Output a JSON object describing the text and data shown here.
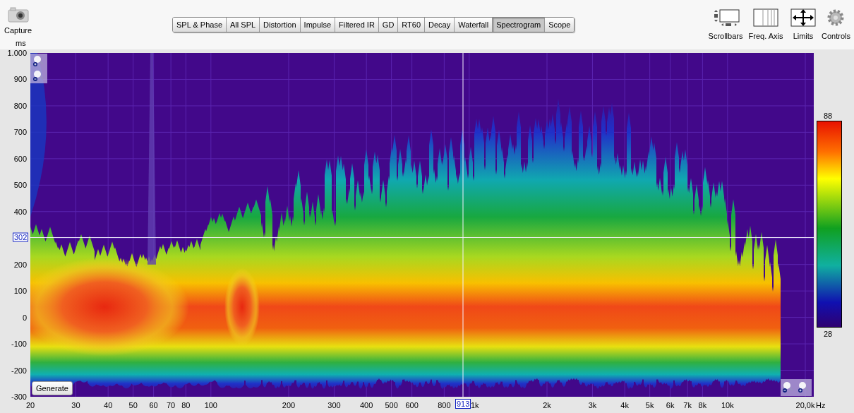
{
  "toolbar": {
    "capture": "Capture",
    "tabs": [
      {
        "label": "SPL & Phase",
        "selected": false
      },
      {
        "label": "All SPL",
        "selected": false
      },
      {
        "label": "Distortion",
        "selected": false
      },
      {
        "label": "Impulse",
        "selected": false
      },
      {
        "label": "Filtered IR",
        "selected": false
      },
      {
        "label": "GD",
        "selected": false
      },
      {
        "label": "RT60",
        "selected": false
      },
      {
        "label": "Decay",
        "selected": false
      },
      {
        "label": "Waterfall",
        "selected": false
      },
      {
        "label": "Spectrogram",
        "selected": true
      },
      {
        "label": "Scope",
        "selected": false
      }
    ],
    "tools": [
      {
        "kind": "scrollbars",
        "label": "Scrollbars"
      },
      {
        "kind": "axis",
        "label": "Freq. Axis"
      },
      {
        "kind": "limits",
        "label": "Limits"
      },
      {
        "kind": "gear",
        "label": "Controls"
      }
    ]
  },
  "graph": {
    "y_unit": "ms",
    "y_ticks": [
      "1.000",
      "900",
      "800",
      "700",
      "600",
      "500",
      "400",
      "200",
      "100",
      "0",
      "-100",
      "-200",
      "-300"
    ],
    "x_ticks": [
      "20",
      "30",
      "40",
      "50",
      "60",
      "70",
      "80",
      "100",
      "200",
      "300",
      "400",
      "500",
      "600",
      "800",
      "1k",
      "2k",
      "3k",
      "4k",
      "5k",
      "6k",
      "7k",
      "8k",
      "10k",
      "20,0k"
    ],
    "x_unit": "Hz",
    "cursor": {
      "time": "302",
      "frequency": "913"
    },
    "generate_button": "Generate",
    "color_scale": {
      "max": "88",
      "min": "28"
    }
  }
}
